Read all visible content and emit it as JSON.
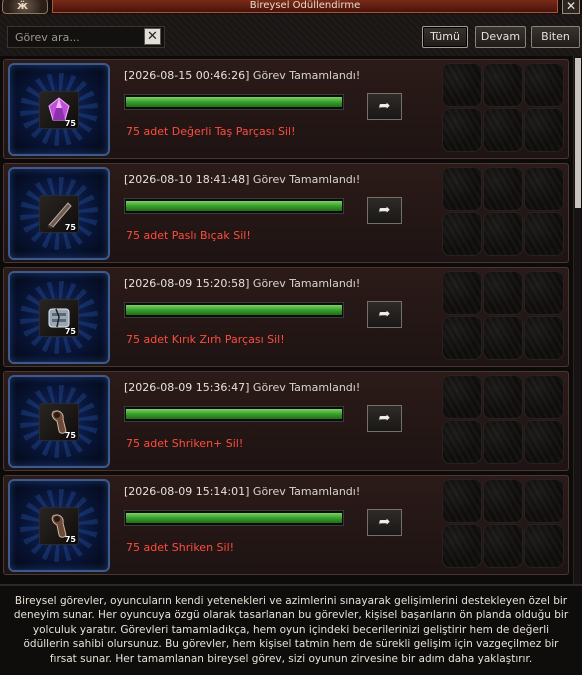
{
  "window": {
    "title": "Bireysel Ödüllendirme",
    "close_label": "✕"
  },
  "toolbar": {
    "search_placeholder": "Görev ara...",
    "clear_label": "✕",
    "filters": [
      "Tümü",
      "Devam",
      "Biten"
    ],
    "active_filter": "Tümü"
  },
  "quests": [
    {
      "timestamp": "[2026-08-15 00:46:26]",
      "status": "Görev Tamamlandı!",
      "task": "75 adet Değerli Taş Parçası Sil!",
      "count": "75",
      "progress": 1.0,
      "icon": "gem-shard-icon"
    },
    {
      "timestamp": "[2026-08-10 18:41:48]",
      "status": "Görev Tamamlandı!",
      "task": "75 adet Paslı Bıçak Sil!",
      "count": "75",
      "progress": 1.0,
      "icon": "rusty-knife-icon"
    },
    {
      "timestamp": "[2026-08-09 15:20:58]",
      "status": "Görev Tamamlandı!",
      "task": "75 adet Kırık Zırh Parçası Sil!",
      "count": "75",
      "progress": 1.0,
      "icon": "broken-armor-icon"
    },
    {
      "timestamp": "[2026-08-09 15:36:47]",
      "status": "Görev Tamamlandı!",
      "task": "75 adet Shriken+ Sil!",
      "count": "75",
      "progress": 1.0,
      "icon": "shuriken-plus-icon"
    },
    {
      "timestamp": "[2026-08-09 15:14:01]",
      "status": "Görev Tamamlandı!",
      "task": "75 adet Shriken Sil!",
      "count": "75",
      "progress": 1.0,
      "icon": "shuriken-icon"
    }
  ],
  "share_label": "➦",
  "description": "Bireysel görevler, oyuncuların kendi yetenekleri ve azimlerini sınayarak gelişimlerini destekleyen özel bir deneyim sunar. Her oyuncuya özgü olarak tasarlanan bu görevler, kişisel başarıların ön planda olduğu bir yolculuk yaratır. Görevleri tamamladıkça, hem oyun içindeki becerilerinizi geliştirir hem de değerli ödüllerin sahibi olursunuz. Bu görevler, hem kişisel tatmin hem de sürekli gelişim için vazgeçilmez bir fırsat sunar. Her tamamlanan bireysel görev, sizi oyunun zirvesine bir adım daha yaklaştırır.",
  "colors": {
    "task_text": "#ff4b40",
    "progress_green": "#3aa02b",
    "slot_glow": "#0f2a6a"
  }
}
